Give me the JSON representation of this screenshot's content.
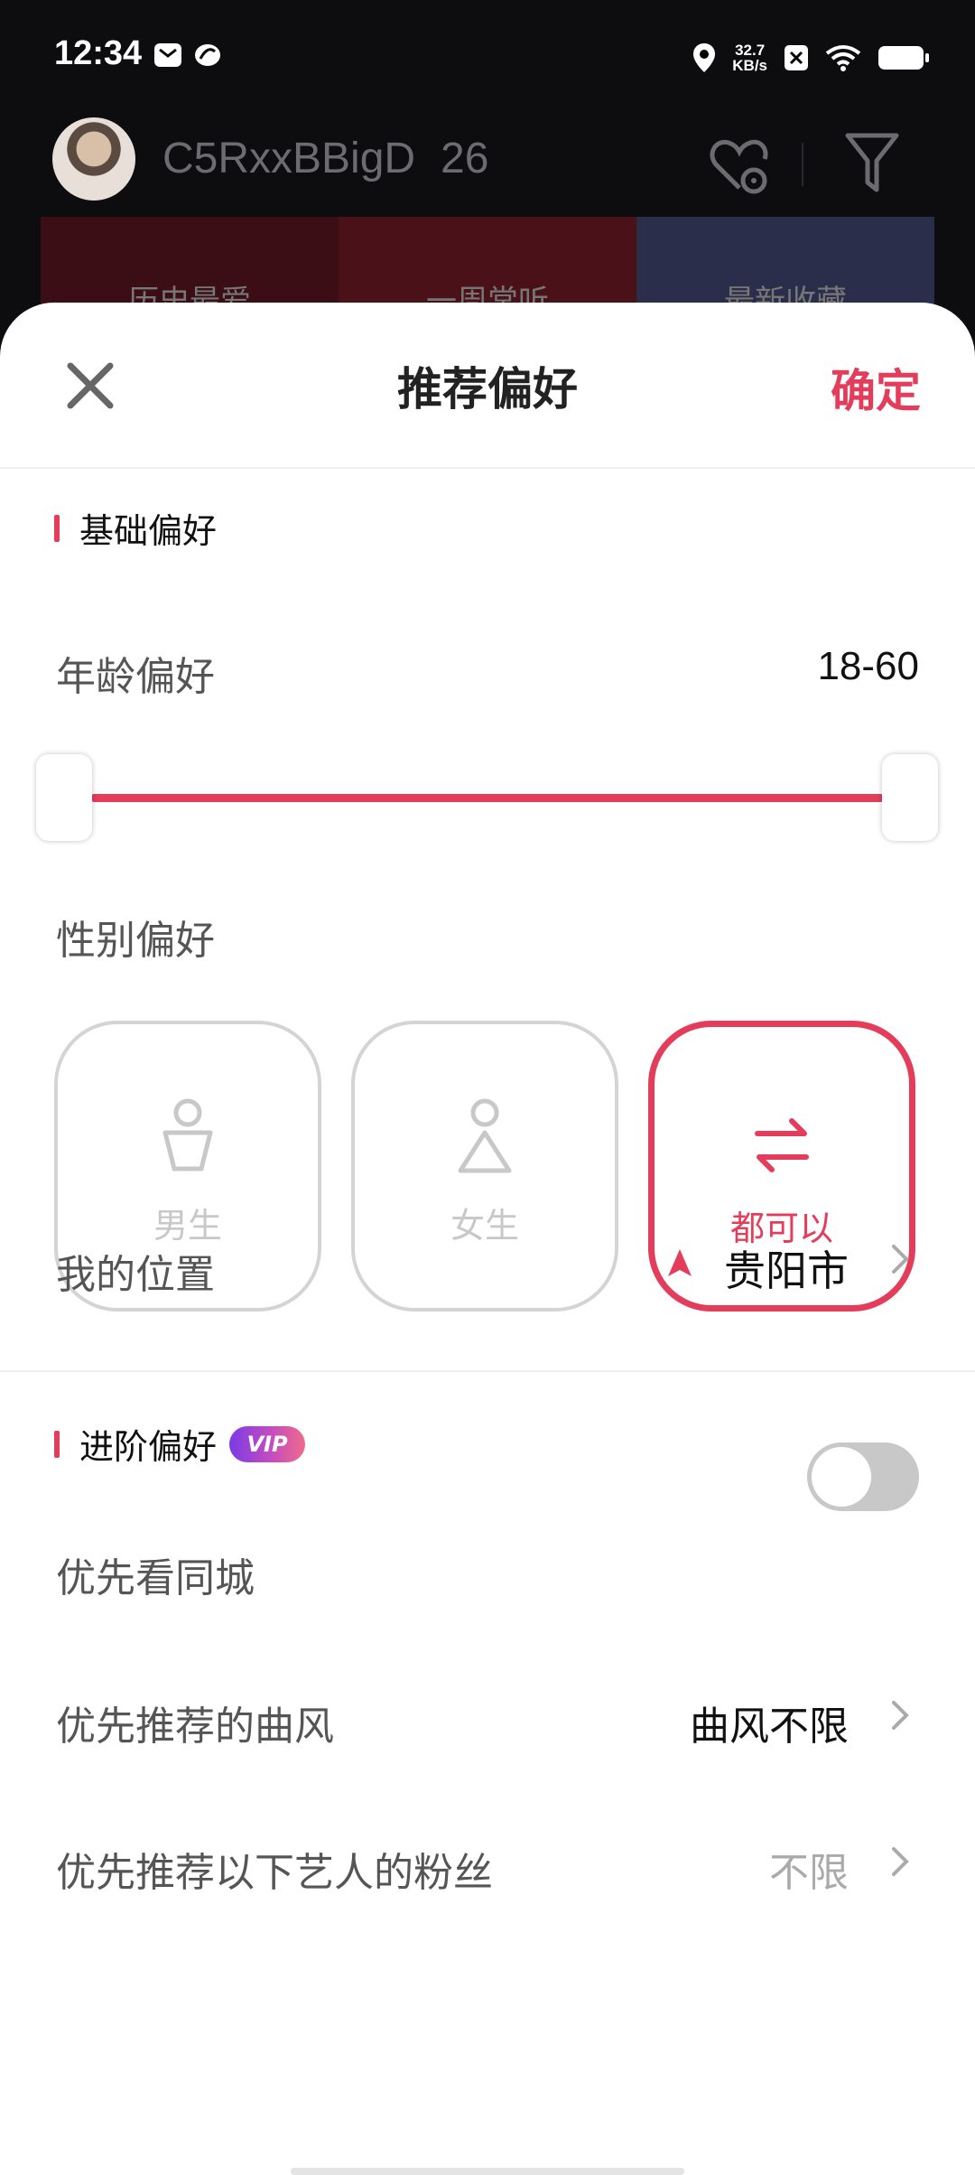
{
  "status_bar": {
    "time": "12:34",
    "speed_value": "32.7",
    "speed_unit": "KB/s"
  },
  "background_app": {
    "username": "C5RxxBBigD",
    "age": "26",
    "cards": [
      "历史最爱",
      "一周常听",
      "最新收藏"
    ]
  },
  "sheet": {
    "title": "推荐偏好",
    "confirm_label": "确定",
    "basic_section_title": "基础偏好",
    "age_label": "年龄偏好",
    "age_range": {
      "display": "18-60",
      "min": 18,
      "max": 60
    },
    "gender_label": "性别偏好",
    "gender_options": [
      {
        "label": "男生",
        "selected": false
      },
      {
        "label": "女生",
        "selected": false
      },
      {
        "label": "都可以",
        "selected": true
      }
    ],
    "location_label": "我的位置",
    "location_value": "贵阳市",
    "advanced_section_title": "进阶偏好",
    "vip_badge": "VIP",
    "same_city_label": "优先看同城",
    "same_city_enabled": false,
    "genre_label": "优先推荐的曲风",
    "genre_value": "曲风不限",
    "artist_fans_label": "优先推荐以下艺人的粉丝",
    "artist_fans_value": "不限"
  },
  "colors": {
    "accent": "#e33d5b",
    "toggle_off": "#c8c8c8"
  }
}
